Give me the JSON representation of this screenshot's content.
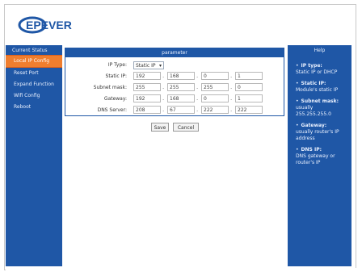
{
  "app": {
    "logo_text": "EPEVER"
  },
  "sidebar": {
    "header": "Current Status",
    "items": [
      {
        "label": "Local IP Config"
      },
      {
        "label": "Reset Port"
      },
      {
        "label": "Expand Function"
      },
      {
        "label": "Wifi Config"
      },
      {
        "label": "Reboot"
      }
    ]
  },
  "panel": {
    "title": "parameter",
    "rows": [
      {
        "label": "IP Type:",
        "type": "select",
        "value": "Static IP"
      },
      {
        "label": "Static IP:",
        "type": "ipv4",
        "values": [
          "192",
          "168",
          "0",
          "1"
        ]
      },
      {
        "label": "Subnet mask:",
        "type": "ipv4",
        "values": [
          "255",
          "255",
          "255",
          "0"
        ]
      },
      {
        "label": "Gateway:",
        "type": "ipv4",
        "values": [
          "192",
          "168",
          "0",
          "1"
        ]
      },
      {
        "label": "DNS Server:",
        "type": "ipv4",
        "values": [
          "208",
          "67",
          "222",
          "222"
        ]
      }
    ]
  },
  "actions": {
    "save": "Save",
    "cancel": "Cancel"
  },
  "help": {
    "title": "Help",
    "entries": [
      {
        "title": "IP type:",
        "text": "Static IP or DHCP"
      },
      {
        "title": "Static IP:",
        "text": "Module's static IP"
      },
      {
        "title": "Subnet mask:",
        "text": "usually 255.255.255.0"
      },
      {
        "title": "Gateway:",
        "text": "usually router's IP address"
      },
      {
        "title": "DNS IP:",
        "text": "DNS gateway or router's IP"
      }
    ]
  },
  "colors": {
    "primary": "#1f57a6",
    "active": "#f07e2e"
  }
}
